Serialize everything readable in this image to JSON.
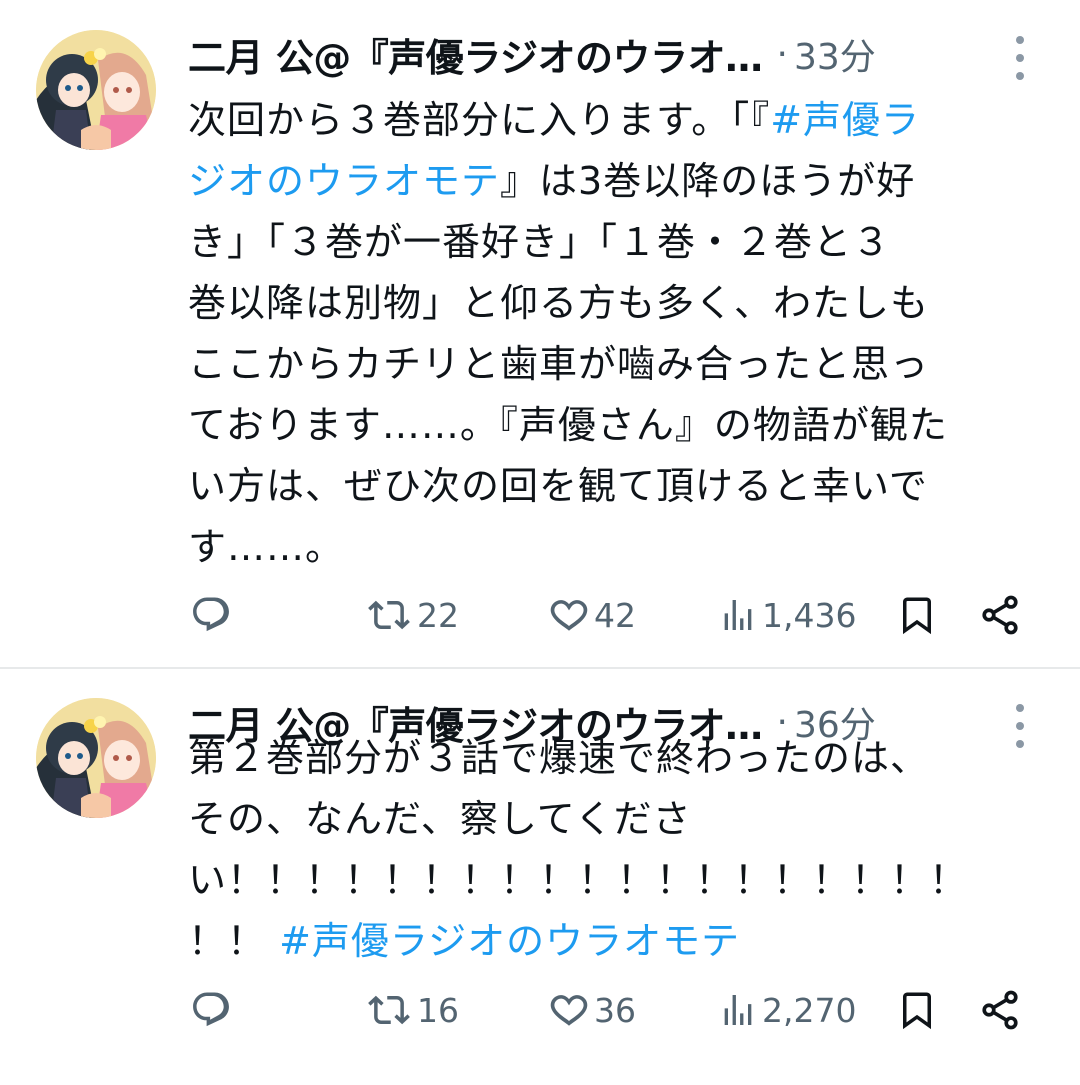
{
  "tweets": [
    {
      "author": "二月 公@『声優ラジオのウラオ…",
      "separator": "·",
      "time": "33分",
      "lines": [
        [
          {
            "text": "次回から３巻部分に入ります。「『"
          },
          {
            "text": "#声優ラ",
            "tag": true
          }
        ],
        [
          {
            "text": "ジオのウラオモテ",
            "tag": true
          },
          {
            "text": "』は3巻以降のほうが好"
          }
        ],
        [
          {
            "text": "き」「３巻が一番好き」「１巻・２巻と３"
          }
        ],
        [
          {
            "text": "巻以降は別物」と仰る方も多く、わたしも"
          }
        ],
        [
          {
            "text": "ここからカチリと歯車が嚙み合ったと思っ"
          }
        ],
        [
          {
            "text": "ております……。『声優さん』の物語が観た"
          }
        ],
        [
          {
            "text": "い方は、ぜひ次の回を観て頂けると幸いで"
          }
        ],
        [
          {
            "text": "す……。"
          }
        ]
      ],
      "actions": {
        "reply": "",
        "retweet": "22",
        "like": "42",
        "views": "1,436"
      }
    },
    {
      "author": "二月 公@『声優ラジオのウラオ…",
      "separator": "·",
      "time": "36分",
      "lines": [
        [
          {
            "text": "第２巻部分が３話で爆速で終わったのは、"
          }
        ],
        [
          {
            "text": "その、なんだ、察してくださ"
          }
        ],
        [
          {
            "text": "い！！！！！！！！！！！！！！！！！！！"
          }
        ],
        [
          {
            "text": "！！ "
          },
          {
            "text": "#声優ラジオのウラオモテ",
            "tag": true
          }
        ]
      ],
      "actions": {
        "reply": "",
        "retweet": "16",
        "like": "36",
        "views": "2,270"
      }
    }
  ],
  "icons": [
    "avatar",
    "more-icon",
    "reply-icon",
    "retweet-icon",
    "like-icon",
    "views-icon",
    "bookmark-icon",
    "share-icon"
  ],
  "colors": {
    "text": "#0f1419",
    "secondary": "#536471",
    "hashtag": "#1d9bf0",
    "divider": "#e7e9ea"
  }
}
